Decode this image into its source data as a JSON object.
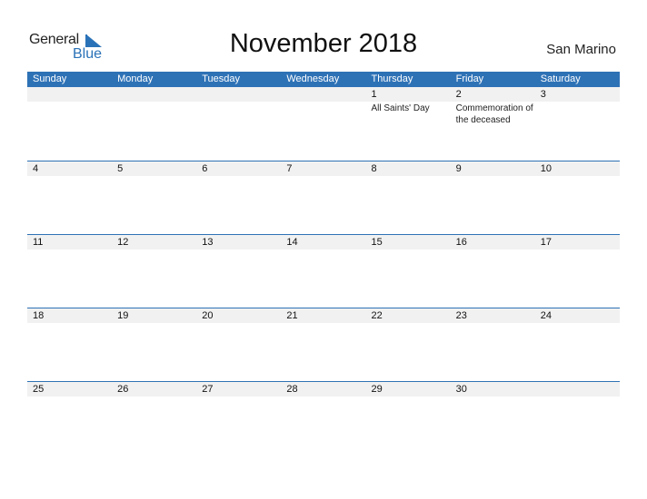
{
  "logo": {
    "line1": "General",
    "line2": "Blue"
  },
  "title": "November 2018",
  "country": "San Marino",
  "colors": {
    "header": "#2e72b6",
    "row_bg": "#f1f1f1",
    "brand": "#2a72b8"
  },
  "weekdays": [
    "Sunday",
    "Monday",
    "Tuesday",
    "Wednesday",
    "Thursday",
    "Friday",
    "Saturday"
  ],
  "weeks": [
    {
      "days": [
        "",
        "",
        "",
        "",
        "1",
        "2",
        "3"
      ],
      "events": [
        "",
        "",
        "",
        "",
        "All Saints' Day",
        "Commemoration of the deceased",
        ""
      ]
    },
    {
      "days": [
        "4",
        "5",
        "6",
        "7",
        "8",
        "9",
        "10"
      ],
      "events": [
        "",
        "",
        "",
        "",
        "",
        "",
        ""
      ]
    },
    {
      "days": [
        "11",
        "12",
        "13",
        "14",
        "15",
        "16",
        "17"
      ],
      "events": [
        "",
        "",
        "",
        "",
        "",
        "",
        ""
      ]
    },
    {
      "days": [
        "18",
        "19",
        "20",
        "21",
        "22",
        "23",
        "24"
      ],
      "events": [
        "",
        "",
        "",
        "",
        "",
        "",
        ""
      ]
    },
    {
      "days": [
        "25",
        "26",
        "27",
        "28",
        "29",
        "30",
        ""
      ],
      "events": [
        "",
        "",
        "",
        "",
        "",
        "",
        ""
      ]
    }
  ]
}
